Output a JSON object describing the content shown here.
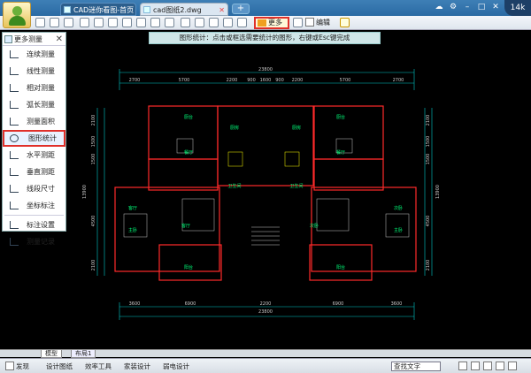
{
  "tabs": [
    {
      "label": "CAD迷你看图-首页",
      "active": false
    },
    {
      "label": "cad图纸2.dwg",
      "active": true
    }
  ],
  "badge": "14k",
  "toolbar": {
    "more_label": "更多",
    "edit_label": "编辑"
  },
  "hint": "图形统计：点击或框选需要统计的图形，右键或Esc键完成",
  "menu": {
    "title": "更多测量",
    "items": [
      "连续测量",
      "线性测量",
      "相对测量",
      "弧长测量",
      "测量面积",
      "图形统计",
      "水平测距",
      "垂直测距",
      "线段尺寸",
      "坐标标注",
      "标注设置",
      "测量记录"
    ],
    "selected": "图形统计"
  },
  "cad": {
    "top_total": "23800",
    "bottom_total": "23800",
    "top_dims": [
      "2700",
      "5700",
      "2200",
      "900",
      "1600",
      "900",
      "2200",
      "5700",
      "2700"
    ],
    "bottom_dims": [
      "3600",
      "6900",
      "2200",
      "6900",
      "3600"
    ],
    "left_dims": [
      "2100",
      "1500",
      "1500",
      "4500",
      "2100"
    ],
    "left_total": "13900",
    "right_dims": [
      "2100",
      "1500",
      "1500",
      "4500",
      "2100"
    ],
    "right_total": "13900",
    "rooms": [
      "厨台",
      "厨房",
      "厨房",
      "厨台",
      "餐厅",
      "餐厅",
      "卫生间",
      "卫生间",
      "主卧",
      "客厅",
      "次卧",
      "主卧",
      "客厅",
      "次卧",
      "阳台",
      "阳台"
    ]
  },
  "layout_tabs": [
    "模型",
    "布局1"
  ],
  "statusbar": {
    "items": [
      "发现",
      "设计图纸",
      "效率工具",
      "家装设计",
      "弱电设计"
    ],
    "search_placeholder": "查找文字"
  },
  "colors": {
    "accent": "#e0302a",
    "wall": "#ff2a2a",
    "dim": "#00c8c8",
    "line": "#c8c8c8"
  }
}
